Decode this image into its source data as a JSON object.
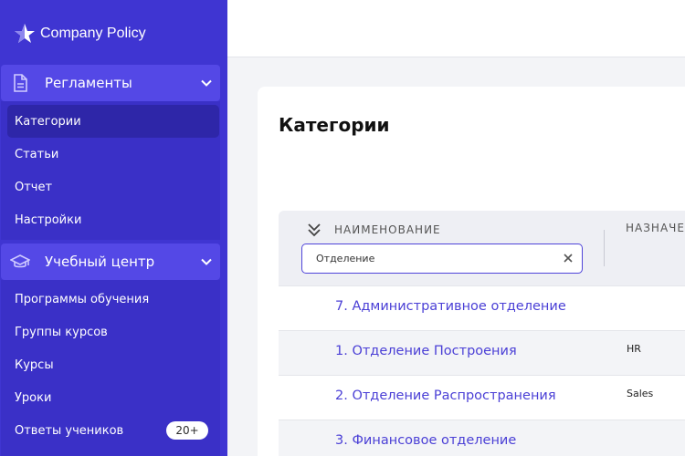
{
  "brand": {
    "title": "Company Policy",
    "icon": "star-icon"
  },
  "sidebar": {
    "groups": [
      {
        "label": "Регламенты",
        "icon": "document-icon",
        "items": [
          {
            "label": "Категории",
            "active": true
          },
          {
            "label": "Статьи"
          },
          {
            "label": "Отчет"
          },
          {
            "label": "Настройки"
          }
        ]
      },
      {
        "label": "Учебный центр",
        "icon": "graduation-cap-icon",
        "items": [
          {
            "label": "Программы обучения"
          },
          {
            "label": "Группы курсов"
          },
          {
            "label": "Курсы"
          },
          {
            "label": "Уроки"
          },
          {
            "label": "Ответы учеников",
            "badge": "20+"
          }
        ]
      }
    ]
  },
  "main": {
    "title": "Категории",
    "table": {
      "columns": [
        "НАИМЕНОВАНИЕ",
        "НАЗНАЧЕН"
      ],
      "filter_value": "Отделение",
      "rows": [
        {
          "name": "7. Административное отделение",
          "assign": ""
        },
        {
          "name": "1. Отделение Построения",
          "assign": "HR"
        },
        {
          "name": "2. Отделение Распространения",
          "assign": "Sales"
        },
        {
          "name": "3. Финансовое отделение",
          "assign": ""
        }
      ]
    }
  },
  "colors": {
    "sidebar": "#3f35d2",
    "accent": "#4b40d6",
    "group_header": "#5448e6"
  }
}
